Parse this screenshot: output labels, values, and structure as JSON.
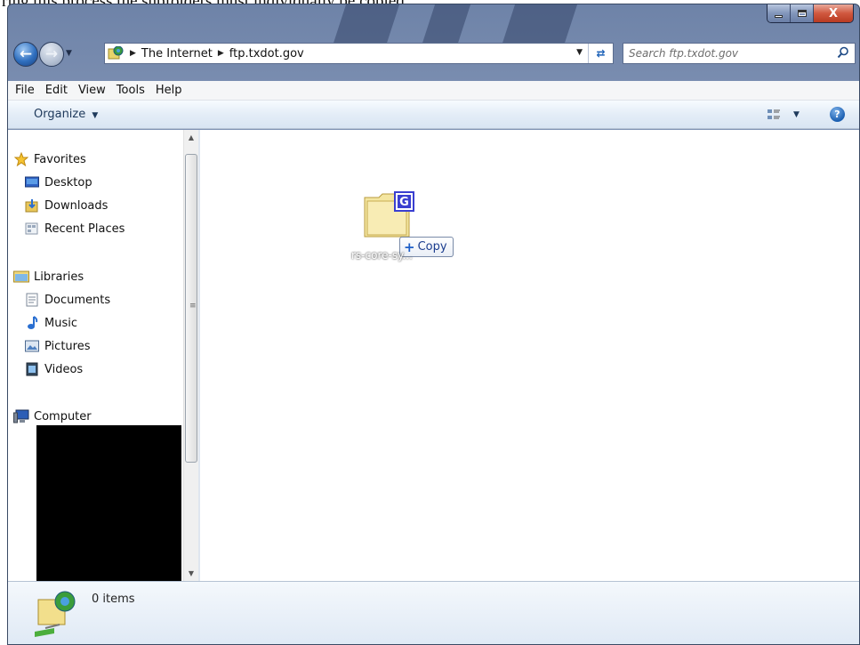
{
  "top_text": "ring this process the subfolders must individually be copied.",
  "window": {
    "caption": {
      "minimize_icon": "minimize-icon",
      "maximize_icon": "maximize-icon",
      "close_glyph": "X"
    }
  },
  "navigation": {
    "breadcrumbs": [
      "The Internet",
      "ftp.txdot.gov"
    ],
    "search_placeholder": "Search ftp.txdot.gov"
  },
  "menu": [
    "File",
    "Edit",
    "View",
    "Tools",
    "Help"
  ],
  "command_bar": {
    "organize_label": "Organize",
    "help_glyph": "?"
  },
  "nav_pane": {
    "favorites": {
      "label": "Favorites",
      "items": [
        "Desktop",
        "Downloads",
        "Recent Places"
      ]
    },
    "libraries": {
      "label": "Libraries",
      "items": [
        "Documents",
        "Music",
        "Pictures",
        "Videos"
      ]
    },
    "computer": {
      "label": "Computer"
    }
  },
  "content": {
    "dragged_item_label": "rs-core-sy...",
    "drag_tooltip": "Copy",
    "folder_badge": "G"
  },
  "details": {
    "item_count": "0 items"
  },
  "colors": {
    "accent_blue": "#1f5fc7",
    "title_glass": "#6e83a8",
    "close_red": "#c8482e"
  }
}
